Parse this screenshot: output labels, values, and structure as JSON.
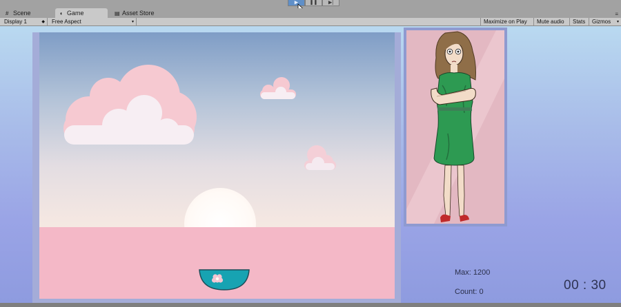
{
  "editor": {
    "tabs": [
      {
        "label": "Scene",
        "icon": "scene-grid-icon"
      },
      {
        "label": "Game",
        "icon": "game-pacman-icon"
      },
      {
        "label": "Asset Store",
        "icon": "asset-store-icon"
      }
    ],
    "play_controls": [
      "play-icon",
      "pause-icon",
      "step-icon"
    ],
    "toolbar": {
      "display": "Display 1",
      "aspect": "Free Aspect",
      "maximize_on_play": "Maximize on Play",
      "mute_audio": "Mute audio",
      "stats": "Stats",
      "gizmos": "Gizmos"
    }
  },
  "game": {
    "max_label": "Max: 1200",
    "count_label": "Count: 0",
    "timer": "00 : 30",
    "colors": {
      "sky_top": "#7f9dc6",
      "ground": "#f4b8c7",
      "bowl": "#17a3b2",
      "dress": "#2d9a52",
      "portrait_bg": "#e3b8c2"
    }
  }
}
